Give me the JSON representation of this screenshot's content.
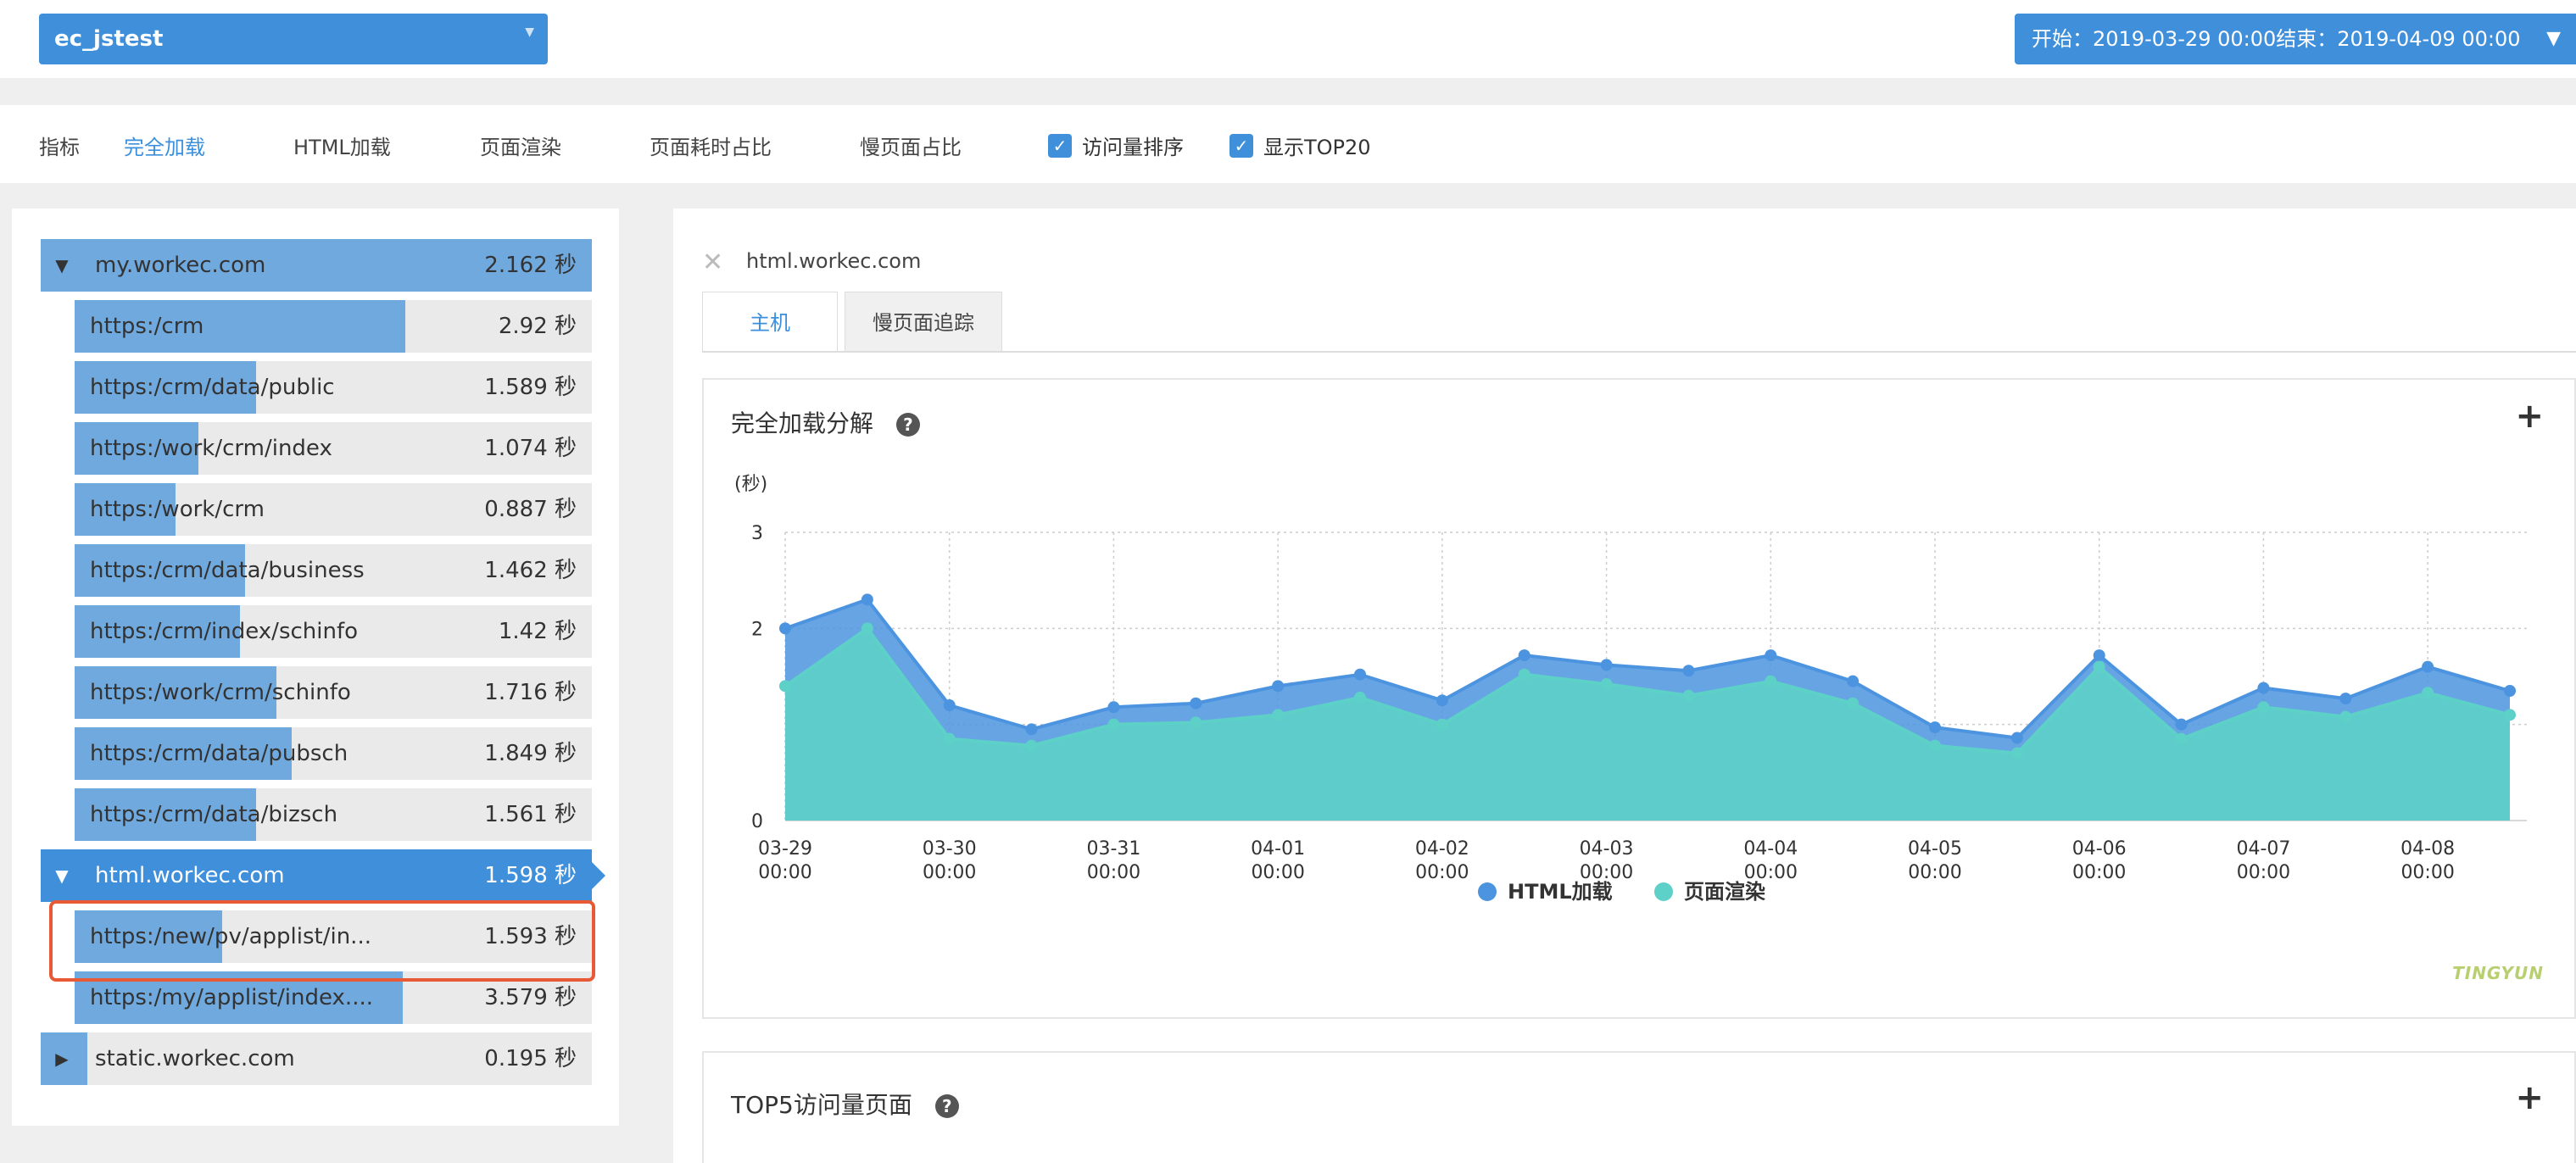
{
  "header": {
    "app_name": "ec_jstest",
    "time_range": "开始：2019-03-29 00:00结束：2019-04-09 00:00"
  },
  "metrics": {
    "label": "指标",
    "tabs": [
      "完全加载",
      "HTML加载",
      "页面渲染",
      "页面耗时占比",
      "慢页面占比"
    ],
    "active_tab": "完全加载",
    "checkboxes": [
      {
        "label": "访问量排序",
        "checked": true
      },
      {
        "label": "显示TOP20",
        "checked": true
      }
    ]
  },
  "tree": {
    "unit": "秒",
    "rows": [
      {
        "kind": "domain",
        "label": "my.workec.com",
        "value": "2.162 秒",
        "expanded": true,
        "fraction": 1.0
      },
      {
        "kind": "child",
        "label": "https:/crm",
        "value": "2.92 秒",
        "fraction": 0.33
      },
      {
        "kind": "child",
        "label": "https:/crm/data/public",
        "value": "1.589 秒",
        "fraction": 0.18
      },
      {
        "kind": "child",
        "label": "https:/work/crm/index",
        "value": "1.074 秒",
        "fraction": 0.12
      },
      {
        "kind": "child",
        "label": "https:/work/crm",
        "value": "0.887 秒",
        "fraction": 0.1
      },
      {
        "kind": "child",
        "label": "https:/crm/data/business",
        "value": "1.462 秒",
        "fraction": 0.165
      },
      {
        "kind": "child",
        "label": "https:/crm/index/schinfo",
        "value": "1.42 秒",
        "fraction": 0.16
      },
      {
        "kind": "child",
        "label": "https:/work/crm/schinfo",
        "value": "1.716 秒",
        "fraction": 0.195
      },
      {
        "kind": "child",
        "label": "https:/crm/data/pubsch",
        "value": "1.849 秒",
        "fraction": 0.21
      },
      {
        "kind": "child",
        "label": "https:/crm/data/bizsch",
        "value": "1.561 秒",
        "fraction": 0.177
      },
      {
        "kind": "domain",
        "label": "html.workec.com",
        "value": "1.598 秒",
        "expanded": true,
        "selected": true,
        "fraction": 1.0
      },
      {
        "kind": "child",
        "label": "https:/new/pv/applist/in...",
        "value": "1.593 秒",
        "fraction": 0.145,
        "highlighted": true
      },
      {
        "kind": "child",
        "label": "https:/my/applist/index....",
        "value": "3.579 秒",
        "fraction": 0.318
      },
      {
        "kind": "domain",
        "label": "static.workec.com",
        "value": "0.195 秒",
        "expanded": false,
        "fraction": 0.0
      }
    ]
  },
  "detail": {
    "host": "html.workec.com",
    "tabs": [
      "主机",
      "慢页面追踪"
    ],
    "active_tab": "主机",
    "chart_card_title": "完全加载分解",
    "top5_card_title": "TOP5访问量页面",
    "watermark_a": "TINGYUN",
    "watermark_b": ""
  },
  "chart_data": {
    "type": "area",
    "title": "完全加载分解",
    "ylabel": "(秒)",
    "ylim": [
      0,
      3
    ],
    "yticks": [
      "0",
      "2",
      "3"
    ],
    "xticks": [
      "03-29\n00:00",
      "03-30\n00:00",
      "03-31\n00:00",
      "04-01\n00:00",
      "04-02\n00:00",
      "04-03\n00:00",
      "04-04\n00:00",
      "04-05\n00:00",
      "04-06\n00:00",
      "04-07\n00:00",
      "04-08\n00:00"
    ],
    "x": [
      "03-29 00:00",
      "03-29 12:00",
      "03-30 00:00",
      "03-30 12:00",
      "03-31 00:00",
      "03-31 12:00",
      "04-01 00:00",
      "04-01 12:00",
      "04-02 00:00",
      "04-02 12:00",
      "04-03 00:00",
      "04-03 12:00",
      "04-04 00:00",
      "04-04 12:00",
      "04-05 00:00",
      "04-05 12:00",
      "04-06 00:00",
      "04-06 12:00",
      "04-07 00:00",
      "04-07 12:00",
      "04-08 00:00",
      "04-08 12:00"
    ],
    "series": [
      {
        "name": "HTML加载",
        "color": "#4c94df",
        "values": [
          2.0,
          2.3,
          1.2,
          0.95,
          1.18,
          1.22,
          1.4,
          1.52,
          1.25,
          1.72,
          1.62,
          1.56,
          1.72,
          1.45,
          0.97,
          0.86,
          1.72,
          1.0,
          1.38,
          1.27,
          1.6,
          1.35
        ]
      },
      {
        "name": "页面渲染",
        "color": "#5dd0c8",
        "values": [
          1.4,
          2.0,
          0.85,
          0.78,
          1.0,
          1.02,
          1.1,
          1.28,
          1.0,
          1.52,
          1.42,
          1.3,
          1.45,
          1.22,
          0.78,
          0.7,
          1.6,
          0.85,
          1.18,
          1.08,
          1.33,
          1.1
        ]
      }
    ],
    "legend": "bottom-center",
    "grid": true
  }
}
